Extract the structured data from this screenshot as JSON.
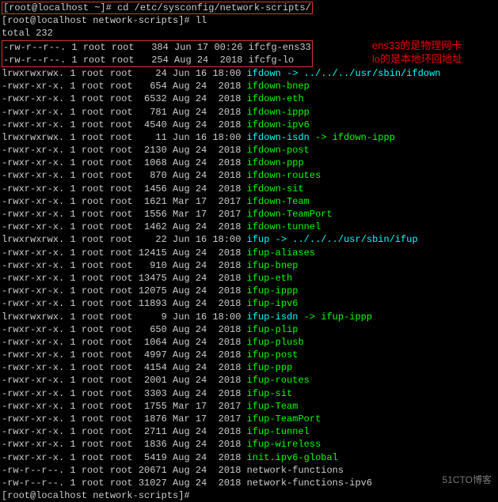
{
  "prompt1_user": "[root@localhost ~]# ",
  "cmd1": "cd /etc/sysconfig/network-scripts/",
  "prompt2_user": "[root@localhost network-scripts]# ",
  "cmd2": "ll",
  "total": "total 232",
  "hl_row1": "-rw-r--r--. 1 root root   384 Jun 17 00:26 ifcfg-ens33",
  "hl_row2": "-rw-r--r--. 1 root root   254 Aug 24  2018 ifcfg-lo",
  "annot1": "ens33的是物理网卡",
  "annot2": "lo的是本地环回地址",
  "rows": [
    {
      "perm": "lrwxrwxrwx. 1 root root    24 Jun 16 18:00 ",
      "fname": "ifdown",
      "fcolor": "cyan",
      "link": " -> ../../../usr/sbin/ifdown",
      "linkcolor": "cyan"
    },
    {
      "perm": "-rwxr-xr-x. 1 root root   654 Aug 24  2018 ",
      "fname": "ifdown-bnep",
      "fcolor": "green"
    },
    {
      "perm": "-rwxr-xr-x. 1 root root  6532 Aug 24  2018 ",
      "fname": "ifdown-eth",
      "fcolor": "green"
    },
    {
      "perm": "-rwxr-xr-x. 1 root root   781 Aug 24  2018 ",
      "fname": "ifdown-ippp",
      "fcolor": "green"
    },
    {
      "perm": "-rwxr-xr-x. 1 root root  4540 Aug 24  2018 ",
      "fname": "ifdown-ipv6",
      "fcolor": "green"
    },
    {
      "perm": "lrwxrwxrwx. 1 root root    11 Jun 16 18:00 ",
      "fname": "ifdown-isdn",
      "fcolor": "cyan",
      "link": " -> ifdown-ippp",
      "linkcolor": "green"
    },
    {
      "perm": "-rwxr-xr-x. 1 root root  2130 Aug 24  2018 ",
      "fname": "ifdown-post",
      "fcolor": "green"
    },
    {
      "perm": "-rwxr-xr-x. 1 root root  1068 Aug 24  2018 ",
      "fname": "ifdown-ppp",
      "fcolor": "green"
    },
    {
      "perm": "-rwxr-xr-x. 1 root root   870 Aug 24  2018 ",
      "fname": "ifdown-routes",
      "fcolor": "green"
    },
    {
      "perm": "-rwxr-xr-x. 1 root root  1456 Aug 24  2018 ",
      "fname": "ifdown-sit",
      "fcolor": "green"
    },
    {
      "perm": "-rwxr-xr-x. 1 root root  1621 Mar 17  2017 ",
      "fname": "ifdown-Team",
      "fcolor": "green"
    },
    {
      "perm": "-rwxr-xr-x. 1 root root  1556 Mar 17  2017 ",
      "fname": "ifdown-TeamPort",
      "fcolor": "green"
    },
    {
      "perm": "-rwxr-xr-x. 1 root root  1462 Aug 24  2018 ",
      "fname": "ifdown-tunnel",
      "fcolor": "green"
    },
    {
      "perm": "lrwxrwxrwx. 1 root root    22 Jun 16 18:00 ",
      "fname": "ifup",
      "fcolor": "cyan",
      "link": " -> ../../../usr/sbin/ifup",
      "linkcolor": "cyan"
    },
    {
      "perm": "-rwxr-xr-x. 1 root root 12415 Aug 24  2018 ",
      "fname": "ifup-aliases",
      "fcolor": "green"
    },
    {
      "perm": "-rwxr-xr-x. 1 root root   910 Aug 24  2018 ",
      "fname": "ifup-bnep",
      "fcolor": "green"
    },
    {
      "perm": "-rwxr-xr-x. 1 root root 13475 Aug 24  2018 ",
      "fname": "ifup-eth",
      "fcolor": "green"
    },
    {
      "perm": "-rwxr-xr-x. 1 root root 12075 Aug 24  2018 ",
      "fname": "ifup-ippp",
      "fcolor": "green"
    },
    {
      "perm": "-rwxr-xr-x. 1 root root 11893 Aug 24  2018 ",
      "fname": "ifup-ipv6",
      "fcolor": "green"
    },
    {
      "perm": "lrwxrwxrwx. 1 root root     9 Jun 16 18:00 ",
      "fname": "ifup-isdn",
      "fcolor": "cyan",
      "link": " -> ifup-ippp",
      "linkcolor": "green"
    },
    {
      "perm": "-rwxr-xr-x. 1 root root   650 Aug 24  2018 ",
      "fname": "ifup-plip",
      "fcolor": "green"
    },
    {
      "perm": "-rwxr-xr-x. 1 root root  1064 Aug 24  2018 ",
      "fname": "ifup-plusb",
      "fcolor": "green"
    },
    {
      "perm": "-rwxr-xr-x. 1 root root  4997 Aug 24  2018 ",
      "fname": "ifup-post",
      "fcolor": "green"
    },
    {
      "perm": "-rwxr-xr-x. 1 root root  4154 Aug 24  2018 ",
      "fname": "ifup-ppp",
      "fcolor": "green"
    },
    {
      "perm": "-rwxr-xr-x. 1 root root  2001 Aug 24  2018 ",
      "fname": "ifup-routes",
      "fcolor": "green"
    },
    {
      "perm": "-rwxr-xr-x. 1 root root  3303 Aug 24  2018 ",
      "fname": "ifup-sit",
      "fcolor": "green"
    },
    {
      "perm": "-rwxr-xr-x. 1 root root  1755 Mar 17  2017 ",
      "fname": "ifup-Team",
      "fcolor": "green"
    },
    {
      "perm": "-rwxr-xr-x. 1 root root  1876 Mar 17  2017 ",
      "fname": "ifup-TeamPort",
      "fcolor": "green"
    },
    {
      "perm": "-rwxr-xr-x. 1 root root  2711 Aug 24  2018 ",
      "fname": "ifup-tunnel",
      "fcolor": "green"
    },
    {
      "perm": "-rwxr-xr-x. 1 root root  1836 Aug 24  2018 ",
      "fname": "ifup-wireless",
      "fcolor": "green"
    },
    {
      "perm": "-rwxr-xr-x. 1 root root  5419 Aug 24  2018 ",
      "fname": "init.ipv6-global",
      "fcolor": "green"
    },
    {
      "perm": "-rw-r--r--. 1 root root 20671 Aug 24  2018 ",
      "fname": "network-functions",
      "fcolor": "gray"
    },
    {
      "perm": "-rw-r--r--. 1 root root 31027 Aug 24  2018 ",
      "fname": "network-functions-ipv6",
      "fcolor": "gray"
    }
  ],
  "prompt3_user": "[root@localhost network-scripts]# ",
  "watermark": "51CTO博客"
}
